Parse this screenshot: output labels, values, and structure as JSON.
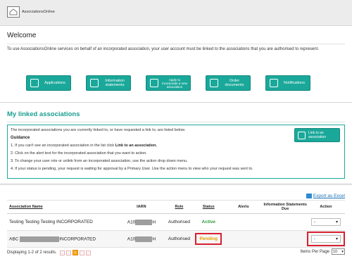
{
  "app": {
    "brand": "AssociationsOnline"
  },
  "welcome": {
    "title": "Welcome",
    "intro": "To use AssociationsOnline services on behalf of an incorporated association, your user account must be linked to the associations that you are authorised to represent."
  },
  "tiles": [
    {
      "label": "Applications",
      "icon": "applications-icon"
    },
    {
      "label": "Information statements",
      "icon": "information-statements-icon"
    },
    {
      "label": "Apply to incorporate a new association",
      "icon": "apply-incorporate-icon"
    },
    {
      "label": "Order documents",
      "icon": "order-documents-icon"
    },
    {
      "label": "Notifications",
      "icon": "notifications-icon"
    }
  ],
  "linked": {
    "title": "My linked associations",
    "intro": "The incorporated associations you are currently linked to, or have requested a link to, are listed below.",
    "guidance_heading": "Guidance",
    "step1_prefix": "1. If you can't see an incorporated association in the list click ",
    "step1_link": "Link to an association.",
    "step2": "2. Click on the alert text for the incorporated association that you want to action.",
    "step3": "3. To change your user role or unlink from an incorporated association, use the action drop down menu.",
    "step4": "4. If your status is pending, your request is waiting for approval by a Primary User. Use the action menu to view who your request was sent to.",
    "link_button": "Link to an association"
  },
  "table": {
    "export_label": "Export as Excel",
    "headers": [
      "Association Name",
      "IARN",
      "Role",
      "Status",
      "Alerts",
      "Information Statements Due",
      "Action"
    ],
    "rows": [
      {
        "name": "Testing Testing Testing INCORPORATED",
        "iarn_prefix": "A10",
        "iarn_suffix": "H",
        "role": "Authorised",
        "status": "Active",
        "alerts": "",
        "due": "",
        "action": "-"
      },
      {
        "name_prefix": "ABC",
        "name_suffix": "INCORPORATED",
        "iarn_prefix": "A10",
        "iarn_suffix": "H",
        "role": "Authorised",
        "status": "Pending",
        "alerts": "",
        "due": "",
        "action": "-"
      }
    ],
    "displaying": "Displaying 1-2 of 2 results.",
    "current_page": "1",
    "items_per_page_label": "Items Per Page",
    "items_per_page": "10"
  },
  "colors": {
    "accent": "#1aa89a",
    "active": "#2e9c3c",
    "pending": "#e6a100",
    "highlight": "#d82030"
  }
}
